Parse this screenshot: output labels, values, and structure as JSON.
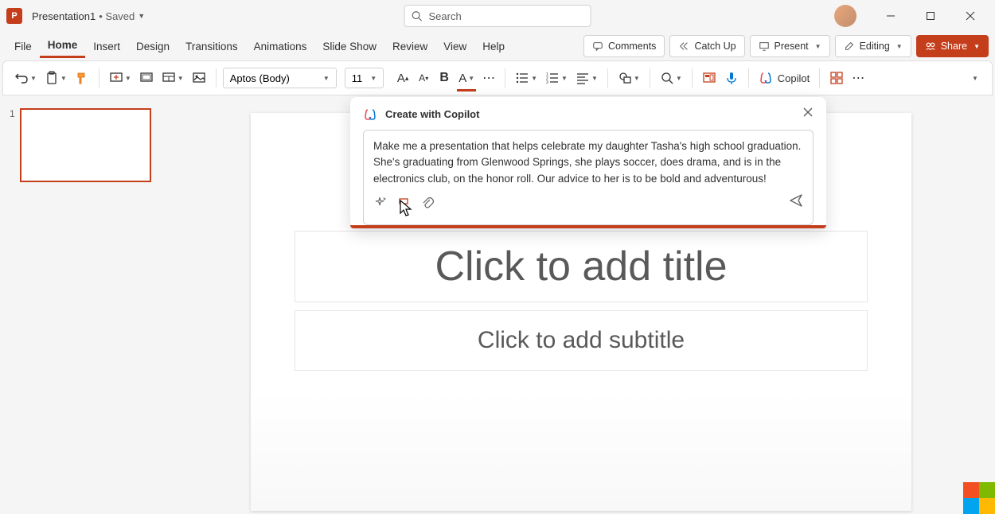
{
  "titlebar": {
    "doc_title": "Presentation1",
    "saved_label": "• Saved",
    "search_placeholder": "Search"
  },
  "menu": {
    "tabs": [
      "File",
      "Home",
      "Insert",
      "Design",
      "Transitions",
      "Animations",
      "Slide Show",
      "Review",
      "View",
      "Help"
    ],
    "active_index": 1,
    "comments": "Comments",
    "catch_up": "Catch Up",
    "present": "Present",
    "editing": "Editing",
    "share": "Share"
  },
  "ribbon": {
    "font_name": "Aptos (Body)",
    "font_size": "11",
    "copilot_label": "Copilot"
  },
  "slides": {
    "items": [
      {
        "number": "1"
      }
    ]
  },
  "slide": {
    "title_placeholder": "Click to add title",
    "subtitle_placeholder": "Click to add subtitle"
  },
  "copilot": {
    "header": "Create with Copilot",
    "prompt_text": "Make me a presentation that helps celebrate my daughter Tasha's high school graduation. She's graduating from Glenwood Springs, she plays soccer, does drama, and is in the electronics club, on the honor roll. Our advice to her is to be bold and adventurous!"
  }
}
